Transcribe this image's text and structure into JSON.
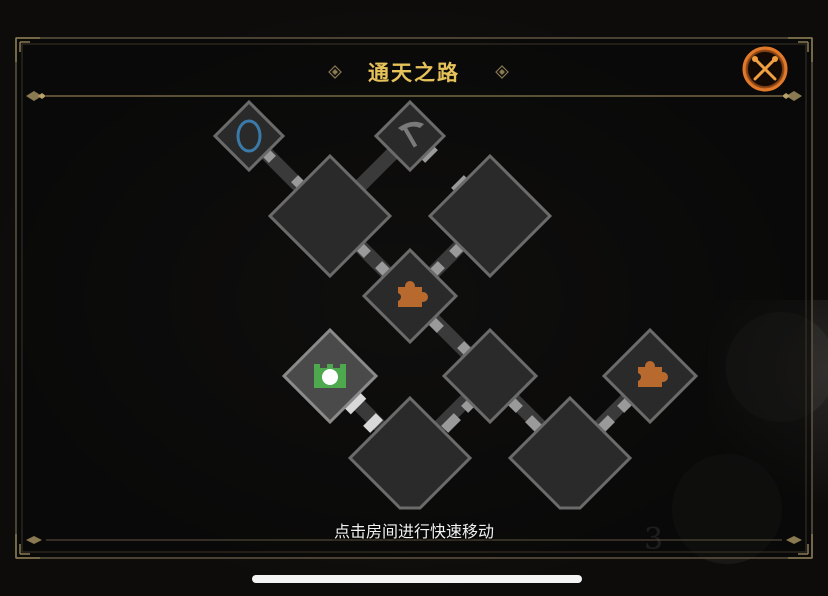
{
  "header": {
    "title": "通天之路",
    "close_icon": "crossed-swords-icon"
  },
  "map": {
    "rooms": [
      {
        "id": "portal-room",
        "kind": "small",
        "icon": "portal-icon"
      },
      {
        "id": "pickaxe-room",
        "kind": "small",
        "icon": "pickaxe-icon"
      },
      {
        "id": "large-room-upper-left",
        "kind": "large",
        "icon": ""
      },
      {
        "id": "large-room-upper-right",
        "kind": "large",
        "icon": ""
      },
      {
        "id": "puzzle-room-center",
        "kind": "medium",
        "icon": "puzzle-icon"
      },
      {
        "id": "current-room",
        "kind": "medium",
        "icon": "castle-icon",
        "current": true
      },
      {
        "id": "medium-room-center",
        "kind": "medium",
        "icon": ""
      },
      {
        "id": "puzzle-room-right",
        "kind": "medium",
        "icon": "puzzle-icon"
      },
      {
        "id": "large-room-lower-left",
        "kind": "large",
        "icon": ""
      },
      {
        "id": "large-room-lower-right",
        "kind": "large",
        "icon": ""
      }
    ]
  },
  "footer": {
    "hint": "点击房间进行快速移动"
  },
  "colors": {
    "title": "#e6c25a",
    "frame": "#8a7a52",
    "room_fill": "#2a2a2a",
    "room_border": "#6b6b6b",
    "puzzle": "#b86a2e",
    "current_room": "#4ea84e",
    "portal": "#3a7aa8"
  }
}
